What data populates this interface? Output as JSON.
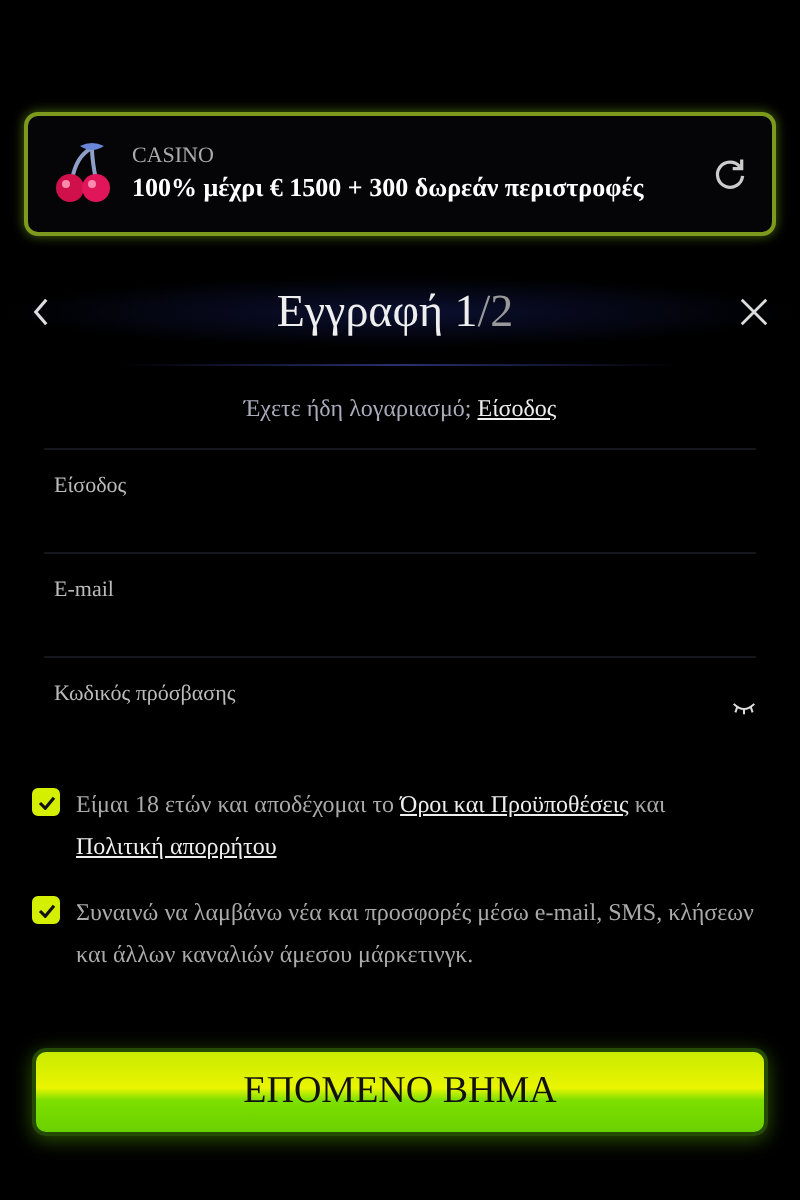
{
  "promo": {
    "label": "CASINO",
    "text": "100% μέχρι € 1500 + 300 δωρεάν περιστροφές"
  },
  "header": {
    "title": "Εγγραφή",
    "step": "1",
    "total": "/2"
  },
  "login_prompt": {
    "text": "Έχετε ήδη λογαριασμό;",
    "link": "Είσοδος"
  },
  "fields": [
    {
      "placeholder": "Είσοδος",
      "kind": "text"
    },
    {
      "placeholder": "E-mail",
      "kind": "text"
    },
    {
      "placeholder": "Κωδικός πρόσβασης",
      "kind": "password"
    }
  ],
  "consents": [
    {
      "checked": true,
      "parts": [
        {
          "text": "Είμαι 18 ετών και αποδέχομαι το"
        },
        {
          "link": "Όροι και Προϋποθέσεις"
        },
        {
          "text": "και"
        },
        {
          "link": "Πολιτική απορρήτου"
        }
      ]
    },
    {
      "checked": true,
      "parts": [
        {
          "text": "Συναινώ να λαμβάνω νέα και προσφορές μέσω e-mail, SMS, κλήσεων και άλλων καναλιών άμεσου μάρκετινγκ."
        }
      ]
    }
  ],
  "next_button": "ΕΠΟΜΕΝΟ ΒΗΜΑ"
}
